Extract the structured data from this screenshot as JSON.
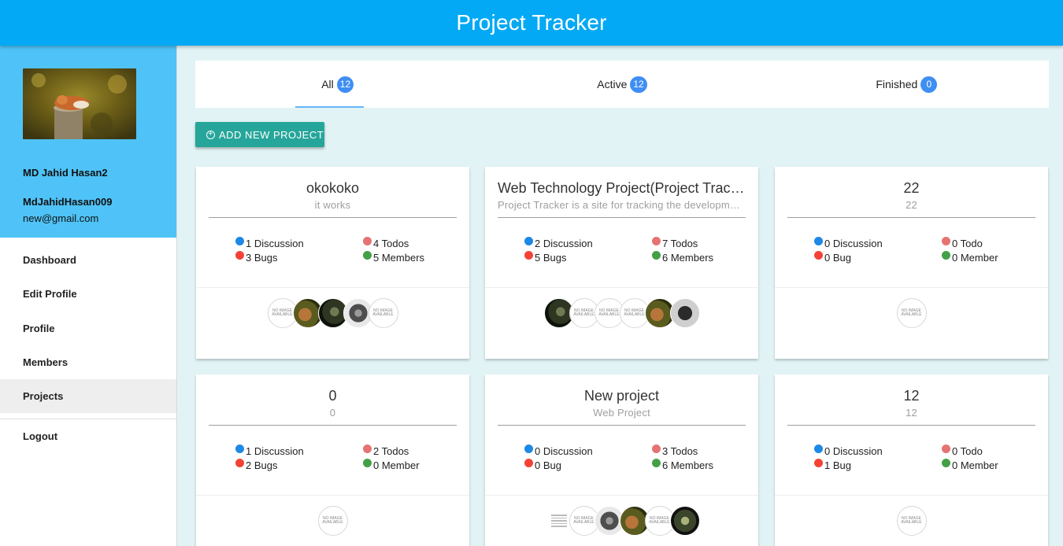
{
  "app": {
    "title": "Project Tracker"
  },
  "profile": {
    "name": "MD Jahid Hasan2",
    "username": "MdJahidHasan009",
    "email": "new@gmail.com",
    "photo": "fox-sleeping-on-stump"
  },
  "nav": {
    "items": [
      "Dashboard",
      "Edit Profile",
      "Profile",
      "Members",
      "Projects"
    ],
    "active": "Projects",
    "logout": "Logout"
  },
  "tabs": [
    {
      "label": "All",
      "count": "12"
    },
    {
      "label": "Active",
      "count": "12"
    },
    {
      "label": "Finished",
      "count": "0"
    }
  ],
  "add_button": {
    "label": "ADD NEW PROJECT",
    "icon": "plus-circle-icon"
  },
  "no_image_text": "NO IMAGE AVAILABLE",
  "colors": {
    "primary": "#03a9f4",
    "sidebar_header": "#4fc3f7",
    "button": "#26a69a",
    "badge": "#3f8ef3",
    "background": "#e1f3f5"
  },
  "projects": [
    {
      "title": "okokoko",
      "subtitle": "it works",
      "discussion": "1 Discussion",
      "todos": "4 Todos",
      "bugs": "3 Bugs",
      "members_count": "5 Members",
      "avatars": [
        "no-image",
        "fox",
        "dark",
        "cat",
        "no-image"
      ]
    },
    {
      "title": "Web Technology Project(Project Tracker)",
      "subtitle": "Project Tracker is a site for tracking the development of projects",
      "discussion": "2 Discussion",
      "todos": "7 Todos",
      "bugs": "5 Bugs",
      "members_count": "6 Members",
      "avatars": [
        "dark",
        "no-image",
        "no-image",
        "no-image",
        "fox",
        "bw"
      ]
    },
    {
      "title": "22",
      "subtitle": "22",
      "discussion": "0 Discussion",
      "todos": "0 Todo",
      "bugs": "0 Bug",
      "members_count": "0 Member",
      "avatars": [
        "no-image"
      ]
    },
    {
      "title": "0",
      "subtitle": "0",
      "discussion": "1 Discussion",
      "todos": "2 Todos",
      "bugs": "2 Bugs",
      "members_count": "0 Member",
      "avatars": [
        "no-image"
      ]
    },
    {
      "title": "New project",
      "subtitle": "Web Project",
      "discussion": "0 Discussion",
      "todos": "3 Todos",
      "bugs": "0 Bug",
      "members_count": "6 Members",
      "avatars": [
        "doc",
        "no-image",
        "cat",
        "fox",
        "no-image",
        "leaf"
      ]
    },
    {
      "title": "12",
      "subtitle": "12",
      "discussion": "0 Discussion",
      "todos": "0 Todo",
      "bugs": "1 Bug",
      "members_count": "0 Member",
      "avatars": [
        "no-image"
      ]
    }
  ]
}
